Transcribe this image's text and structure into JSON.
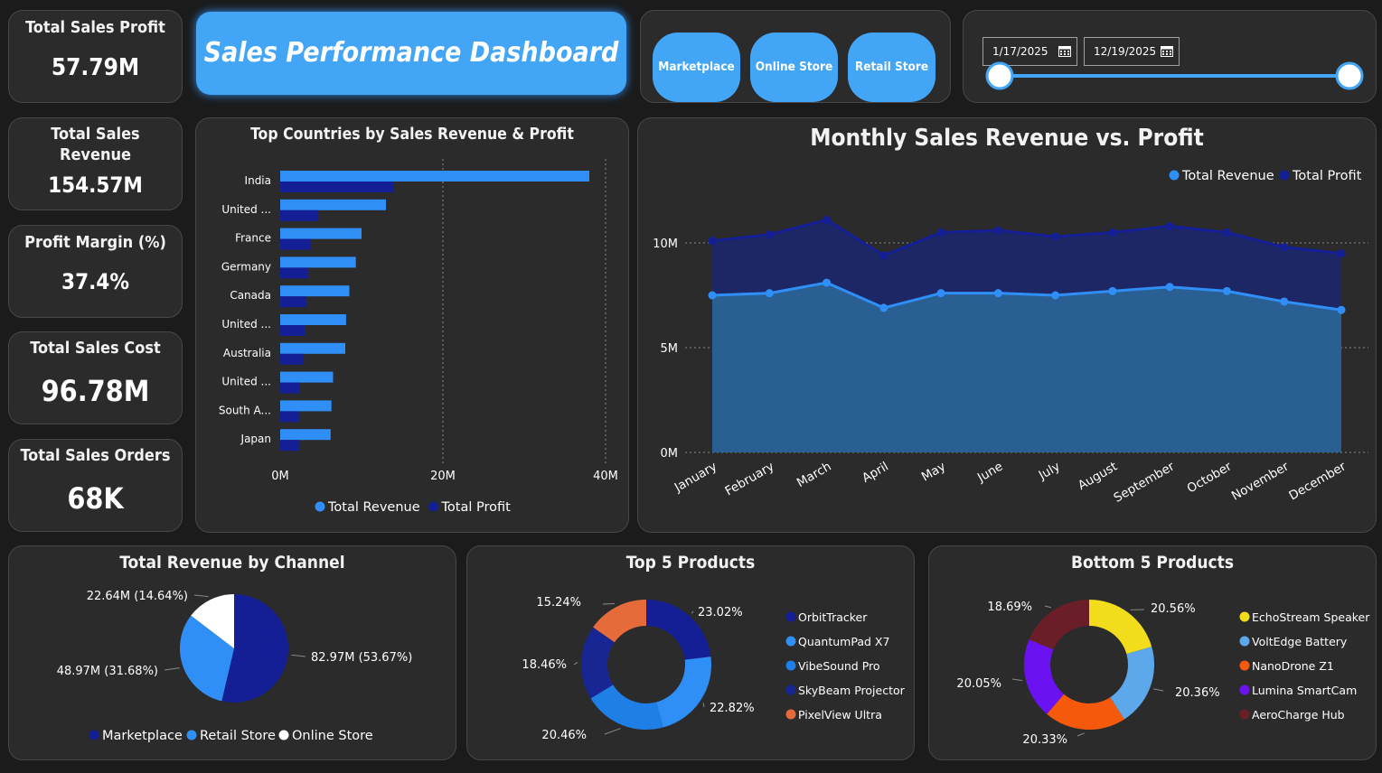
{
  "dashboard_title": "Sales Performance Dashboard",
  "kpis": {
    "profit": {
      "title": "Total Sales Profit",
      "value": "57.79M"
    },
    "revenue": {
      "title_line1": "Total Sales",
      "title_line2": "Revenue",
      "value": "154.57M"
    },
    "margin": {
      "title": "Profit Margin (%)",
      "value": "37.4%"
    },
    "cost": {
      "title": "Total Sales Cost",
      "value": "96.78M"
    },
    "orders": {
      "title": "Total Sales Orders",
      "value": "68K"
    }
  },
  "channel_buttons": [
    "Marketplace",
    "Online Store",
    "Retail Store"
  ],
  "date_filter": {
    "start": "1/17/2025",
    "end": "12/19/2025",
    "range_fraction": [
      0.0,
      1.0
    ]
  },
  "colors": {
    "accent": "#42a5f5",
    "revenue_blue": "#2f8ff7",
    "profit_navy": "#141f96",
    "panel": "#2b2b2b",
    "background": "#1b1b1b"
  },
  "chart_data": [
    {
      "id": "countries",
      "type": "bar",
      "orientation": "horizontal",
      "title": "Top Countries by Sales Revenue & Profit",
      "categories": [
        "India",
        "United ...",
        "France",
        "Germany",
        "Canada",
        "United ...",
        "Australia",
        "United ...",
        "South A...",
        "Japan"
      ],
      "series": [
        {
          "name": "Total Revenue",
          "color": "#2f8ff7",
          "values": [
            38.0,
            13.0,
            10.0,
            9.3,
            8.5,
            8.1,
            8.0,
            6.5,
            6.3,
            6.2
          ]
        },
        {
          "name": "Total Profit",
          "color": "#141f96",
          "values": [
            14.0,
            4.7,
            3.8,
            3.4,
            3.2,
            3.0,
            2.9,
            2.4,
            2.3,
            2.3
          ]
        }
      ],
      "xlim": [
        0,
        40
      ],
      "xticks": [
        "0M",
        "20M",
        "40M"
      ],
      "grid": true,
      "legend": "bottom"
    },
    {
      "id": "monthly",
      "type": "area",
      "title": "Monthly Sales Revenue vs. Profit",
      "x": [
        "January",
        "February",
        "March",
        "April",
        "May",
        "June",
        "July",
        "August",
        "September",
        "October",
        "November",
        "December"
      ],
      "series": [
        {
          "name": "Total Revenue",
          "color": "#2f8ff7",
          "values": [
            10.1,
            10.4,
            11.1,
            9.4,
            10.5,
            10.6,
            10.3,
            10.5,
            10.8,
            10.5,
            9.8,
            9.5
          ]
        },
        {
          "name": "Total Profit",
          "color": "#141f96",
          "values": [
            7.5,
            7.6,
            8.1,
            6.9,
            7.6,
            7.6,
            7.5,
            7.7,
            7.9,
            7.7,
            7.2,
            6.8
          ]
        }
      ],
      "ylim": [
        0,
        12
      ],
      "yticks": [
        "0M",
        "5M",
        "10M"
      ],
      "grid": true,
      "legend": "top-right"
    },
    {
      "id": "channel",
      "type": "pie",
      "title": "Total Revenue by Channel",
      "slices": [
        {
          "name": "Marketplace",
          "value": 82.97,
          "label": "82.97M (53.67%)",
          "color": "#141f96"
        },
        {
          "name": "Retail Store",
          "value": 48.97,
          "label": "48.97M (31.68%)",
          "color": "#2f8ff7"
        },
        {
          "name": "Online Store",
          "value": 22.64,
          "label": "22.64M (14.64%)",
          "color": "#ffffff"
        }
      ],
      "legend": "bottom"
    },
    {
      "id": "top5",
      "type": "pie",
      "donut": true,
      "title": "Top 5 Products",
      "slices": [
        {
          "name": "OrbitTracker",
          "value": 23.02,
          "label": "23.02%",
          "color": "#141f96"
        },
        {
          "name": "QuantumPad X7",
          "value": 22.82,
          "label": "22.82%",
          "color": "#2f8ff7"
        },
        {
          "name": "VibeSound Pro",
          "value": 20.46,
          "label": "20.46%",
          "color": "#1e7fe6"
        },
        {
          "name": "SkyBeam Projector",
          "value": 18.46,
          "label": "18.46%",
          "color": "#172692"
        },
        {
          "name": "PixelView Ultra",
          "value": 15.24,
          "label": "15.24%",
          "color": "#e56b3b"
        }
      ],
      "legend": "right"
    },
    {
      "id": "bottom5",
      "type": "pie",
      "donut": true,
      "title": "Bottom 5 Products",
      "slices": [
        {
          "name": "EchoStream Speaker",
          "value": 20.56,
          "label": "20.56%",
          "color": "#f2dd1c"
        },
        {
          "name": "VoltEdge Battery",
          "value": 20.36,
          "label": "20.36%",
          "color": "#5da8ea"
        },
        {
          "name": "NanoDrone Z1",
          "value": 20.33,
          "label": "20.33%",
          "color": "#f5590b"
        },
        {
          "name": "Lumina SmartCam",
          "value": 20.05,
          "label": "20.05%",
          "color": "#6a12f2"
        },
        {
          "name": "AeroCharge Hub",
          "value": 18.69,
          "label": "18.69%",
          "color": "#6a1f28"
        }
      ],
      "legend": "right"
    }
  ]
}
